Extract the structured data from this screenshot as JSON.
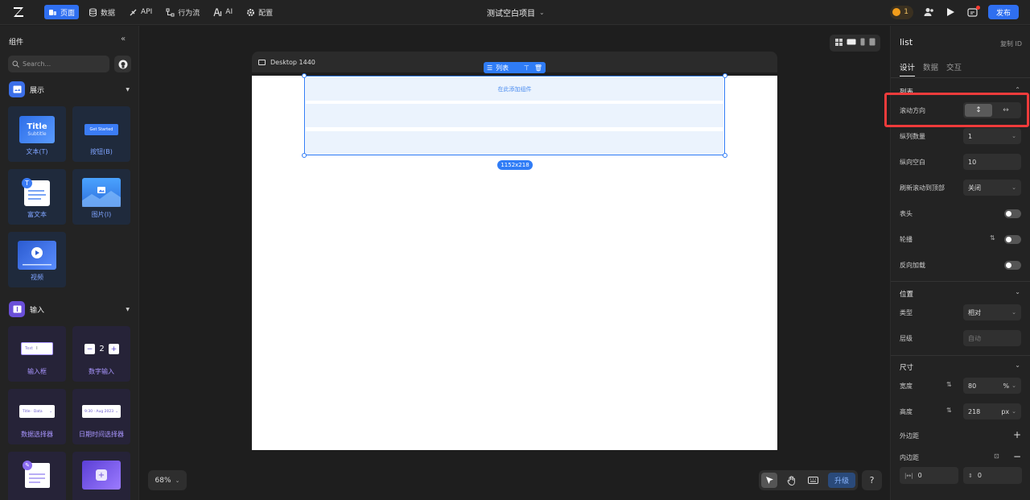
{
  "topbar": {
    "nav": [
      {
        "label": "页面",
        "icon": "page-icon",
        "active": true
      },
      {
        "label": "数据",
        "icon": "database-icon",
        "active": false
      },
      {
        "label": "API",
        "icon": "api-icon",
        "active": false
      },
      {
        "label": "行为流",
        "icon": "flow-icon",
        "active": false
      },
      {
        "label": "AI",
        "icon": "ai-icon",
        "active": false
      },
      {
        "label": "配置",
        "icon": "gear-icon",
        "active": false
      }
    ],
    "project_name": "测试空白项目",
    "coins": "1",
    "publish_label": "发布"
  },
  "left_panel": {
    "title": "组件",
    "search_placeholder": "Search...",
    "sections": [
      {
        "label": "展示",
        "items": [
          {
            "label": "文本(T)",
            "thumb_title": "Title",
            "thumb_subtitle": "Subtitle"
          },
          {
            "label": "按钮(B)",
            "thumb_text": "Get Started"
          },
          {
            "label": "富文本",
            "thumb_badge": "T"
          },
          {
            "label": "图片(I)"
          },
          {
            "label": "视频"
          }
        ]
      },
      {
        "label": "输入",
        "items": [
          {
            "label": "输入框",
            "thumb_text": "Text"
          },
          {
            "label": "数字输入",
            "thumb_text": "2"
          },
          {
            "label": "数据选择器",
            "thumb_text": "Title · Data"
          },
          {
            "label": "日期时间选择器",
            "thumb_text": "9:30 · Aug 2023"
          },
          {
            "label": ""
          },
          {
            "label": ""
          }
        ]
      }
    ]
  },
  "canvas": {
    "frame_label": "Desktop 1440",
    "selected_tag": "列表",
    "list_hint": "在此添加组件",
    "dimensions": "1152x218",
    "zoom": "68%",
    "upgrade_label": "升级",
    "help": "?"
  },
  "right_panel": {
    "title": "list",
    "copy_id": "复制 ID",
    "tabs": [
      {
        "label": "设计",
        "active": true
      },
      {
        "label": "数据",
        "active": false
      },
      {
        "label": "交互",
        "active": false
      }
    ],
    "list_section": {
      "title": "列表",
      "scroll_direction": {
        "label": "滚动方向",
        "vertical": "↕",
        "horizontal": "↔",
        "selected": "vertical"
      },
      "columns": {
        "label": "纵列数量",
        "value": "1"
      },
      "v_gap": {
        "label": "纵向空白",
        "value": "10"
      },
      "refresh_scroll": {
        "label": "刷新滚动到顶部",
        "value": "关闭"
      },
      "header": {
        "label": "表头",
        "on": false
      },
      "carousel": {
        "label": "轮播",
        "on": false
      },
      "reverse_load": {
        "label": "反向加载",
        "on": false
      }
    },
    "position_section": {
      "title": "位置",
      "type": {
        "label": "类型",
        "value": "相对"
      },
      "layer": {
        "label": "层级",
        "placeholder": "自动"
      }
    },
    "size_section": {
      "title": "尺寸",
      "width": {
        "label": "宽度",
        "value": "80",
        "unit": "%"
      },
      "height": {
        "label": "高度",
        "value": "218",
        "unit": "px"
      },
      "margin": {
        "label": "外边距"
      },
      "padding": {
        "label": "内边距",
        "h_value": "0",
        "v_value": "0"
      }
    }
  },
  "colors": {
    "accent": "#2f6ff0",
    "highlight": "#ef3b3b",
    "panel_bg": "#232323",
    "canvas_bg": "#1e1e1e"
  }
}
